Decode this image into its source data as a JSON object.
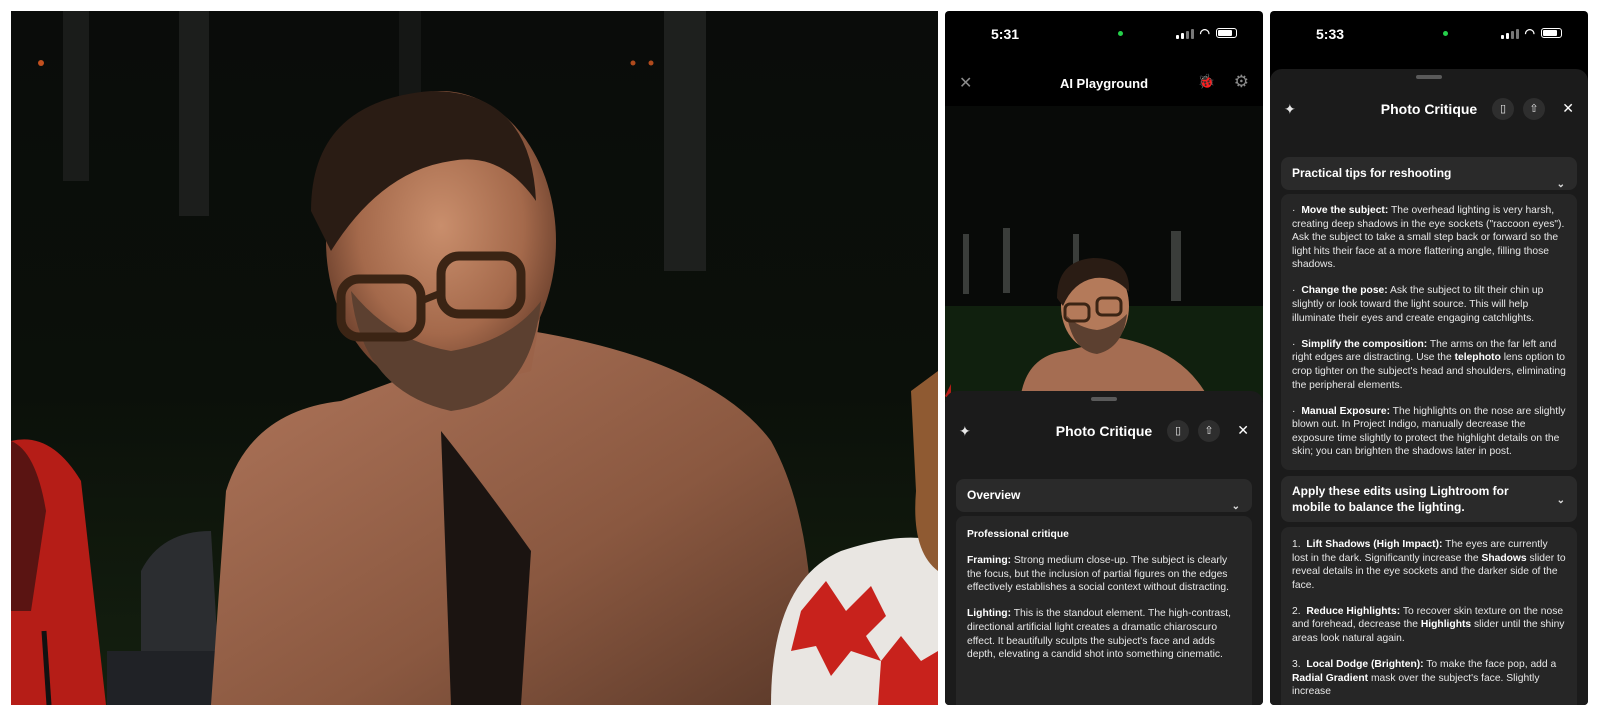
{
  "phone1": {
    "status": {
      "time": "5:31"
    },
    "app_title": "AI Playground",
    "sheet_title": "Photo Critique",
    "section_title": "Overview",
    "card_heading": "Professional critique",
    "paragraphs": [
      {
        "label": "Framing:",
        "text": " Strong medium close-up. The subject is clearly the focus, but the inclusion of partial figures on the edges effectively establishes a social context without distracting."
      },
      {
        "label": "Lighting:",
        "text": " This is the standout element. The high-contrast, directional artificial light creates a dramatic chiaroscuro effect. It beautifully sculpts the subject's face and adds depth, elevating a candid shot into something cinematic."
      }
    ]
  },
  "phone2": {
    "status": {
      "time": "5:33"
    },
    "sheet_title": "Photo Critique",
    "section1_title": "Practical tips for reshooting",
    "tips": [
      {
        "label": "Move the subject:",
        "text": " The overhead lighting is very harsh, creating deep shadows in the eye sockets (\"raccoon eyes\"). Ask the subject to take a small step back or forward so the light hits their face at a more flattering angle, filling those shadows."
      },
      {
        "label": "Change the pose:",
        "text": " Ask the subject to tilt their chin up slightly or look toward the light source. This will help illuminate their eyes and create engaging catchlights."
      },
      {
        "label": "Simplify the composition:",
        "text_a": " The arms on the far left and right edges are distracting. Use the ",
        "bold": "telephoto",
        "text_b": " lens option to crop tighter on the subject's head and shoulders, eliminating the peripheral elements."
      },
      {
        "label": "Manual Exposure:",
        "text": " The highlights on the nose are slightly blown out. In Project Indigo, manually decrease the exposure time slightly to protect the highlight details on the skin; you can brighten the shadows later in post."
      }
    ],
    "section2_title": "Apply these edits using Lightroom for mobile to balance the lighting.",
    "edits": [
      {
        "num": "1.",
        "label": "Lift Shadows (High Impact):",
        "text_a": " The eyes are currently lost in the dark. Significantly increase the ",
        "bold": "Shadows",
        "text_b": " slider to reveal details in the eye sockets and the darker side of the face."
      },
      {
        "num": "2.",
        "label": "Reduce Highlights:",
        "text_a": " To recover skin texture on the nose and forehead, decrease the ",
        "bold": "Highlights",
        "text_b": " slider until the shiny areas look natural again."
      },
      {
        "num": "3.",
        "label": "Local Dodge (Brighten):",
        "text_a": " To make the face pop, add a ",
        "bold": "Radial Gradient",
        "text_b": " mask over the subject's face. Slightly increase"
      }
    ]
  },
  "icons": {
    "close": "close-icon",
    "bug": "bug-icon",
    "gear": "gear-icon",
    "sparkle": "sparkle-icon",
    "phone": "phone-icon",
    "share": "share-icon",
    "chevron": "chevron-down-icon"
  },
  "colors": {
    "background": "#000000",
    "sheet": "#1b1b1b",
    "card": "#262626",
    "status_dot": "#25d04a"
  }
}
